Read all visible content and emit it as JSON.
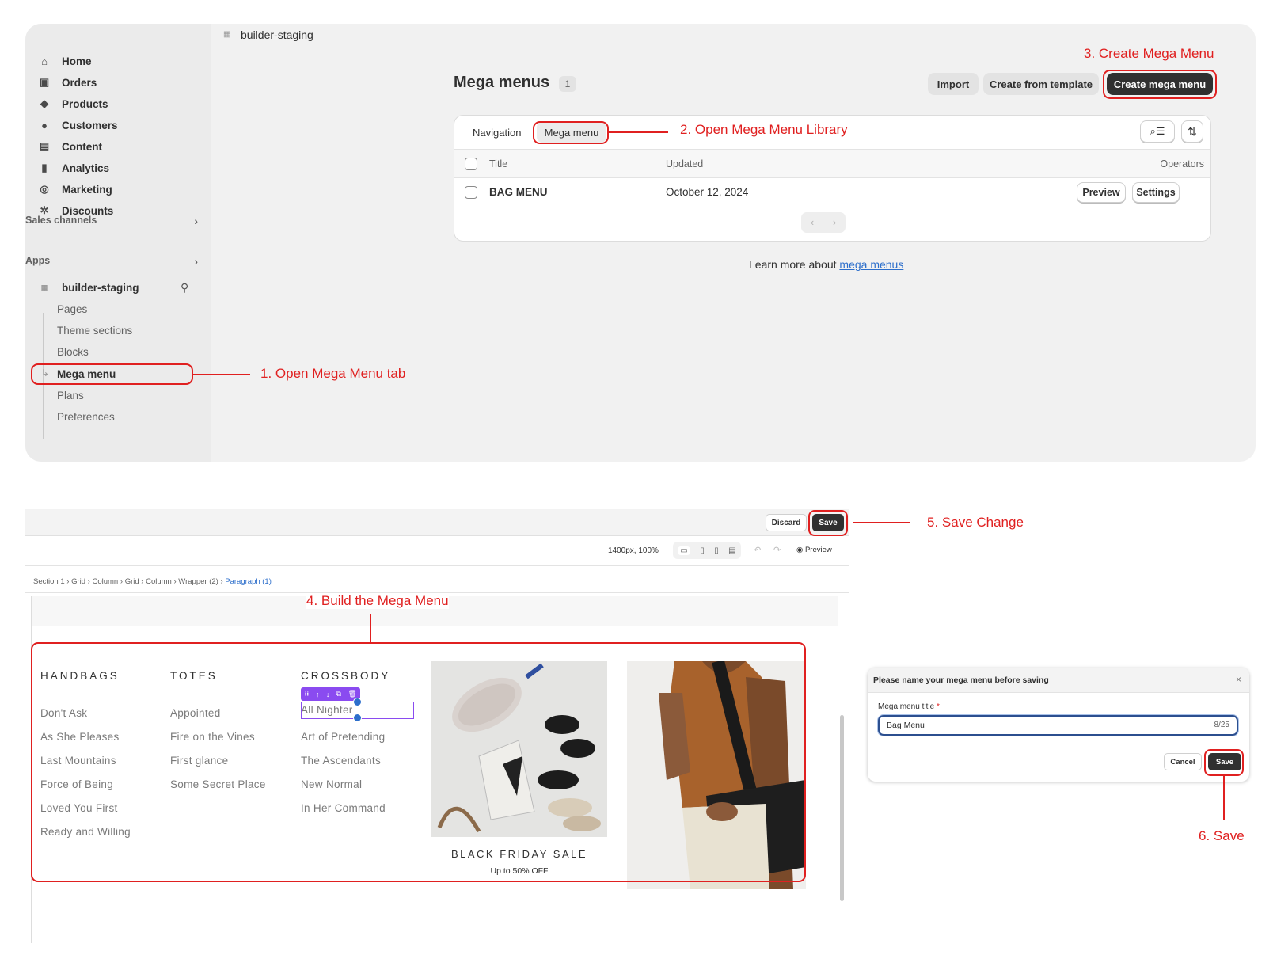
{
  "sidebar": {
    "nav": [
      {
        "label": "Home",
        "icon": "home-icon"
      },
      {
        "label": "Orders",
        "icon": "orders-icon"
      },
      {
        "label": "Products",
        "icon": "tag-icon"
      },
      {
        "label": "Customers",
        "icon": "person-icon"
      },
      {
        "label": "Content",
        "icon": "content-icon"
      },
      {
        "label": "Analytics",
        "icon": "bar-chart-icon"
      },
      {
        "label": "Marketing",
        "icon": "target-icon"
      },
      {
        "label": "Discounts",
        "icon": "discount-icon"
      }
    ],
    "sales_channels": "Sales channels",
    "apps": "Apps",
    "app_name": "builder-staging",
    "app_items": [
      "Pages",
      "Theme sections",
      "Blocks",
      "Mega menu",
      "Plans",
      "Preferences"
    ]
  },
  "topbar": {
    "title": "builder-staging"
  },
  "page": {
    "title": "Mega menus",
    "count": "1",
    "import": "Import",
    "from_template": "Create from template",
    "create": "Create mega menu",
    "tabs": [
      "Navigation",
      "Mega menu"
    ],
    "columns": {
      "title": "Title",
      "updated": "Updated",
      "operators": "Operators"
    },
    "rows": [
      {
        "title": "BAG MENU",
        "updated": "October 12, 2024",
        "preview": "Preview",
        "settings": "Settings"
      }
    ],
    "learn_prefix": "Learn more about ",
    "learn_link": "mega menus"
  },
  "annotations": {
    "a1": "1. Open Mega Menu tab",
    "a2": "2. Open Mega Menu Library",
    "a3": "3. Create Mega Menu",
    "a4": "4. Build the Mega Menu",
    "a5": "5. Save Change",
    "a6": "6. Save"
  },
  "editor": {
    "discard": "Discard",
    "save": "Save",
    "size": "1400px, 100%",
    "preview": "Preview",
    "breadcrumb": [
      "Section 1",
      "Grid",
      "Column",
      "Grid",
      "Column",
      "Wrapper (2)",
      "Paragraph (1)"
    ],
    "columns": [
      {
        "heading": "HANDBAGS",
        "links": [
          "Don't Ask",
          "As She Pleases",
          "Last Mountains",
          "Force of Being",
          "Loved You First",
          "Ready and Willing"
        ]
      },
      {
        "heading": "TOTES",
        "links": [
          "Appointed",
          "Fire on the Vines",
          "First glance",
          "Some Secret Place"
        ]
      },
      {
        "heading": "CROSSBODY",
        "links": [
          "All Nighter",
          "Art of Pretending",
          "The Ascendants",
          "New Normal",
          "In Her Command"
        ]
      }
    ],
    "promo_title": "BLACK FRIDAY SALE",
    "promo_sub": "Up to 50% OFF"
  },
  "dialog": {
    "title": "Please name your mega menu before saving",
    "label": "Mega menu title",
    "required": "*",
    "value": "Bag Menu",
    "counter": "8/25",
    "cancel": "Cancel",
    "save": "Save"
  },
  "colors": {
    "accent_red": "#e02020",
    "dark_button": "#303030",
    "selection_purple": "#8a4bf0",
    "link_blue": "#2c6ecb"
  }
}
